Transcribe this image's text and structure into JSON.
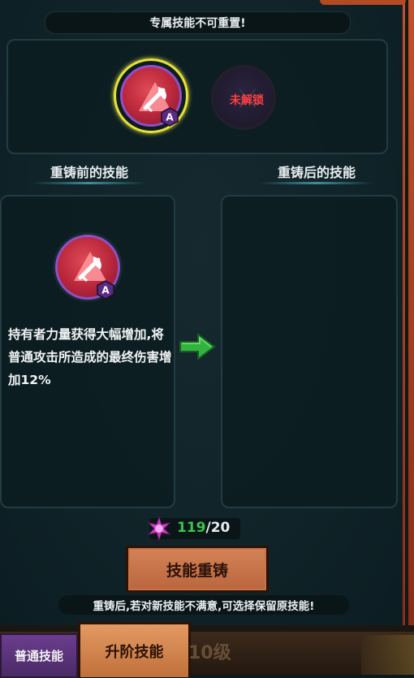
{
  "header": {
    "notice": "专属技能不可重置!"
  },
  "slots": {
    "current_badge": "A",
    "locked_label": "未解锁"
  },
  "labels": {
    "before": "重铸前的技能",
    "after": "重铸后的技能"
  },
  "current_skill": {
    "badge": "A",
    "description": "持有者力量获得大幅增加,将普通攻击所造成的最终伤害增加12%"
  },
  "cost": {
    "owned": "119",
    "required": "/20"
  },
  "actions": {
    "reforge_label": "技能重铸"
  },
  "footer": {
    "hint": "重铸后,若对新技能不满意,可选择保留原技能!"
  },
  "tabs": {
    "normal": "普通技能",
    "upgrade": "升阶技能",
    "level": "10级"
  },
  "colors": {
    "accent": "#38c64a",
    "button": "#c97447",
    "locked": "#ff3f3f",
    "ring": "#e8e23a"
  },
  "icons": {
    "skill": "axe-icon",
    "arrow": "green-arrow-icon",
    "cost": "purple-crystal-icon",
    "badge": "rank-a-badge-icon",
    "lock": "lock-icon"
  }
}
